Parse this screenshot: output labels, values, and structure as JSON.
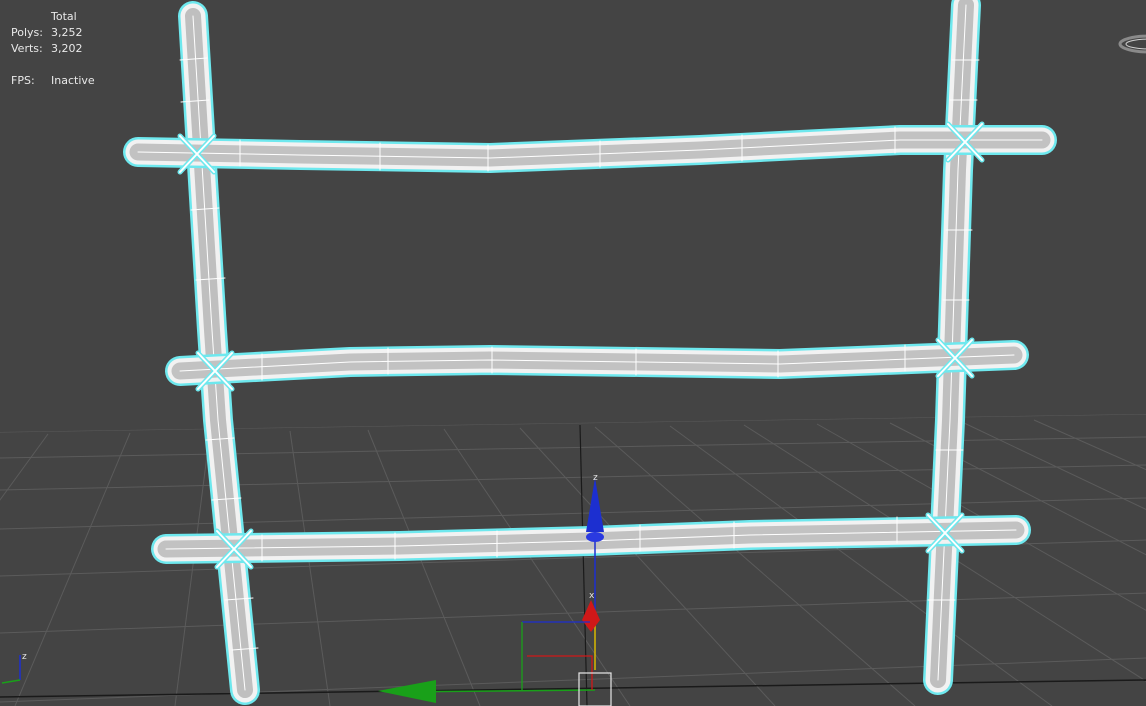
{
  "stats": {
    "header": "Total",
    "polys_label": "Polys:",
    "polys_value": "3,252",
    "verts_label": "Verts:",
    "verts_value": "3,202",
    "fps_label": "FPS:",
    "fps_value": "Inactive"
  },
  "gizmo": {
    "x_letter": "x",
    "z_letter": "z"
  },
  "corner_axes": {
    "z_letter": "z"
  },
  "colors": {
    "background": "#444444",
    "grid": "#5a5a5a",
    "selection_outline": "#6ee8ee",
    "wireframe": "#ffffff",
    "axis_x": "#d01818",
    "axis_y": "#19a019",
    "axis_z": "#1c2fd0"
  },
  "icons": {
    "gizmo": "transform-gizmo-icon",
    "viewcube": "viewcube-icon",
    "axis_tripod": "axis-tripod-icon"
  }
}
